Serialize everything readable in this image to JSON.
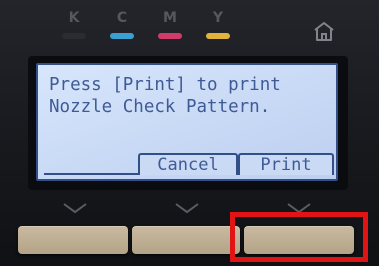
{
  "ink_indicators": [
    {
      "letter": "K",
      "color": "#2a2c31"
    },
    {
      "letter": "C",
      "color": "#3b9fd0"
    },
    {
      "letter": "M",
      "color": "#d23a6a"
    },
    {
      "letter": "Y",
      "color": "#e2b33a"
    }
  ],
  "lcd": {
    "line1": "Press [Print] to print",
    "line2": "Nozzle Check Pattern.",
    "softkeys": {
      "cancel_label": "Cancel",
      "print_label": "Print"
    }
  },
  "icons": {
    "home": "home-icon",
    "chevron": "chevron-down-icon"
  },
  "colors": {
    "lcd_background": "#c7d8f5",
    "lcd_text": "#3f5b96",
    "button": "#bfae93",
    "highlight": "#e01414"
  }
}
